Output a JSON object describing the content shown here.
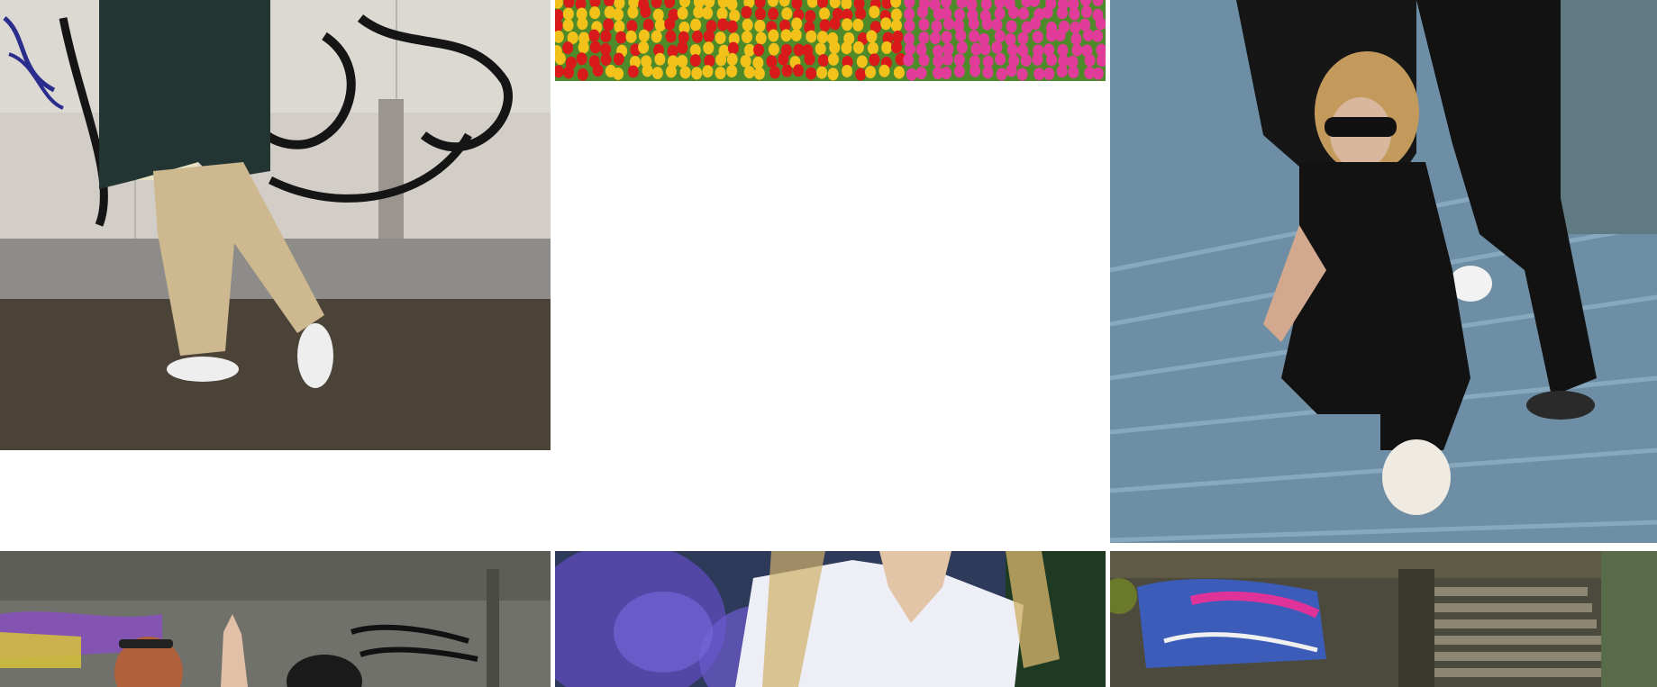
{
  "gallery": {
    "photos": [
      {
        "id": "photo-1",
        "subject": "person-graffiti-wall",
        "colors": {
          "wall": "#d8d4ce",
          "ground": "#4a4137",
          "jacket": "#223532",
          "pants": "#cdb88f"
        }
      },
      {
        "id": "photo-2",
        "subject": "tulip-field",
        "colors": {
          "red": "#d91a1a",
          "yellow": "#f2c21b",
          "pink": "#e23c9a",
          "leaf": "#4f8a2a"
        }
      },
      {
        "id": "photo-3",
        "subject": "woman-on-stairs",
        "colors": {
          "stone": "#6b8ca3",
          "outfit": "#121212",
          "hair": "#c49a5c"
        }
      },
      {
        "id": "photo-4",
        "subject": "friends-concrete-wall",
        "colors": {
          "wall": "#7b7d76",
          "graffiti": "#8a4ec4",
          "hair": "#b0603a"
        }
      },
      {
        "id": "photo-5",
        "subject": "woman-purple-flowers",
        "colors": {
          "bokeh": "#5b4bb8",
          "shirt": "#eeeef6",
          "hair": "#d1b06a"
        }
      },
      {
        "id": "photo-6",
        "subject": "graffiti-stairs",
        "colors": {
          "wall": "#4c4a3c",
          "graffiti": "#3a5fd0",
          "stairs": "#8d8673"
        }
      }
    ]
  }
}
